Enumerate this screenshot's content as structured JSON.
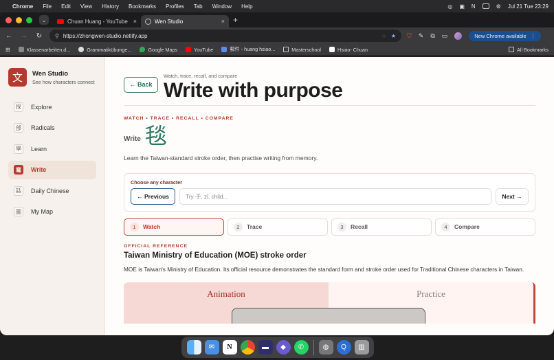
{
  "menubar": {
    "app": "Chrome",
    "items": [
      "File",
      "Edit",
      "View",
      "History",
      "Bookmarks",
      "Profiles",
      "Tab",
      "Window",
      "Help"
    ],
    "clock": "Jul 21 Tue  23:29"
  },
  "tabs": [
    {
      "title": "Chuan Huang - YouTube"
    },
    {
      "title": "Wen Studio"
    }
  ],
  "address_bar": {
    "url": "https://zhongwen-studio.netlify.app",
    "new_chrome_label": "New Chrome available"
  },
  "bookmarks": [
    {
      "label": "Klassenarbeiten.d...",
      "icon": "bookmark-icon"
    },
    {
      "label": "Grammatikübunge...",
      "icon": "wordpress-icon"
    },
    {
      "label": "Google Maps",
      "icon": "maps-icon"
    },
    {
      "label": "YouTube",
      "icon": "youtube-icon"
    },
    {
      "label": "郵件 - huang hsiao...",
      "icon": "mail-icon"
    },
    {
      "label": "Masterschool",
      "icon": "folder-icon"
    },
    {
      "label": "Hsiao- Chuan",
      "icon": "notion-icon"
    }
  ],
  "all_bookmarks_label": "All Bookmarks",
  "sidebar": {
    "logo_char": "文",
    "title": "Wen Studio",
    "subtitle": "See how characters connect",
    "items": [
      {
        "glyph": "探",
        "label": "Explore"
      },
      {
        "glyph": "部",
        "label": "Radicals"
      },
      {
        "glyph": "學",
        "label": "Learn"
      },
      {
        "glyph": "寫",
        "label": "Write"
      },
      {
        "glyph": "話",
        "label": "Daily Chinese"
      },
      {
        "glyph": "圖",
        "label": "My Map"
      }
    ]
  },
  "header": {
    "back_label": "← Back",
    "kicker": "Watch, trace, recall, and compare",
    "title": "Write with purpose"
  },
  "practice": {
    "eyebrow": "WATCH • TRACE • RECALL • COMPARE",
    "write_label": "Write",
    "character": "毯",
    "intro": "Learn the Taiwan-standard stroke order, then practise writing from memory."
  },
  "chooser": {
    "label": "Choose any character",
    "prev_label": "← Previous",
    "placeholder": "Try 子, zǐ, child...",
    "next_label": "Next →"
  },
  "steps": [
    {
      "num": "1",
      "label": "Watch"
    },
    {
      "num": "2",
      "label": "Trace"
    },
    {
      "num": "3",
      "label": "Recall"
    },
    {
      "num": "4",
      "label": "Compare"
    }
  ],
  "reference": {
    "eyebrow": "OFFICIAL REFERENCE",
    "title": "Taiwan Ministry of Education (MOE) stroke order",
    "description": "MOE is Taiwan's Ministry of Education. Its official resource demonstrates the standard form and stroke order used for Traditional Chinese characters in Taiwan."
  },
  "panel_tabs": {
    "animation": "Animation",
    "practice": "Practice"
  }
}
